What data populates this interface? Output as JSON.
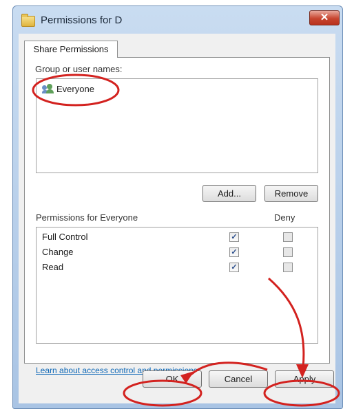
{
  "window": {
    "title": "Permissions for D",
    "close_symbol": "✕"
  },
  "tabs": [
    {
      "label": "Share Permissions"
    }
  ],
  "group": {
    "label": "Group or user names:",
    "users": [
      {
        "name": "Everyone"
      }
    ],
    "add_label": "Add...",
    "remove_label": "Remove"
  },
  "permissions": {
    "header": "Permissions for Everyone",
    "allow_header": "",
    "deny_header": "Deny",
    "rows": [
      {
        "name": "Full Control",
        "allow": true,
        "deny": false
      },
      {
        "name": "Change",
        "allow": true,
        "deny": false
      },
      {
        "name": "Read",
        "allow": true,
        "deny": false
      }
    ]
  },
  "link": {
    "text": "Learn about access control and permissions"
  },
  "footer": {
    "ok_label": "OK",
    "cancel_label": "Cancel",
    "apply_label": "Apply"
  },
  "check_symbol": "✓",
  "colors": {
    "annotation": "#d3221f",
    "titlebar": "#b9d1ec",
    "link": "#0b66b6"
  },
  "icons": [
    "folder-icon",
    "close-icon",
    "users-icon",
    "checkbox-icon"
  ]
}
